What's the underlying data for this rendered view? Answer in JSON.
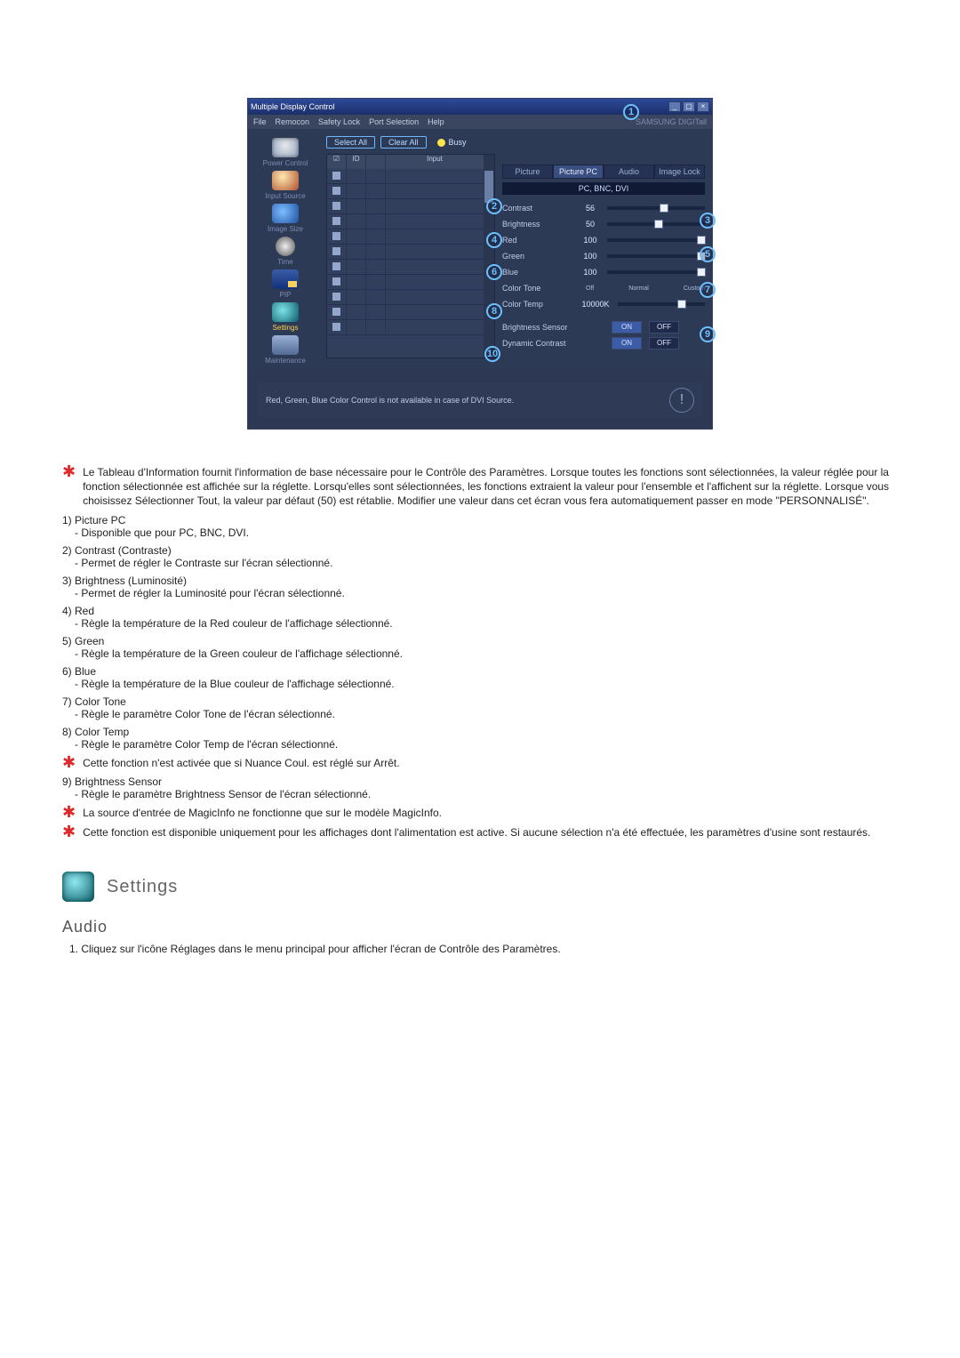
{
  "app": {
    "title": "Multiple Display Control",
    "menus": [
      "File",
      "Remocon",
      "Safety Lock",
      "Port Selection",
      "Help"
    ],
    "brand": "SAMSUNG DIGITall"
  },
  "sidebar": {
    "items": [
      {
        "label": "Power Control"
      },
      {
        "label": "Input Source"
      },
      {
        "label": "Image Size"
      },
      {
        "label": "Time"
      },
      {
        "label": "PIP"
      },
      {
        "label": "Settings"
      },
      {
        "label": "Maintenance"
      }
    ]
  },
  "listpanel": {
    "select_all": "Select All",
    "clear_all": "Clear All",
    "busy": "Busy",
    "cols": {
      "chk": "",
      "id": "ID",
      "st": "",
      "input": "Input"
    }
  },
  "rightpanel": {
    "tabs": [
      "Picture",
      "Picture PC",
      "Audio",
      "Image Lock"
    ],
    "active_tab": 1,
    "banner": "PC, BNC, DVI",
    "sliders": {
      "contrast": {
        "label": "Contrast",
        "val": "56",
        "pct": 56
      },
      "brightness": {
        "label": "Brightness",
        "val": "50",
        "pct": 50
      },
      "red": {
        "label": "Red",
        "val": "100",
        "pct": 100
      },
      "green": {
        "label": "Green",
        "val": "100",
        "pct": 100
      },
      "blue": {
        "label": "Blue",
        "val": "100",
        "pct": 100
      }
    },
    "colortone": {
      "label": "Color Tone",
      "opts": [
        "Off",
        "Normal",
        "Custom"
      ]
    },
    "colortemp": {
      "label": "Color Temp",
      "val": "10000K"
    },
    "bsensor": {
      "label": "Brightness Sensor",
      "on": "ON",
      "off": "OFF"
    },
    "dcontrast": {
      "label": "Dynamic Contrast",
      "on": "ON",
      "off": "OFF"
    }
  },
  "callouts": [
    "1",
    "2",
    "3",
    "4",
    "5",
    "6",
    "7",
    "8",
    "9",
    "10"
  ],
  "notebar": "Red, Green, Blue Color Control is not available in case of DVI Source.",
  "doc": {
    "intro_star": "Le Tableau d'Information fournit l'information de base nécessaire pour le Contrôle des Paramètres. Lorsque toutes les fonctions sont sélectionnées, la valeur réglée pour la fonction sélectionnée est affichée sur la réglette. Lorsqu'elles sont sélectionnées, les fonctions extraient la valeur pour l'ensemble et l'affichent sur la réglette. Lorsque vous choisissez Sélectionner Tout, la valeur par défaut (50) est rétablie. Modifier une valeur dans cet écran vous fera automatiquement passer en mode \"PERSONNALISÉ\".",
    "items": [
      {
        "lbl": "1) Picture PC",
        "desc": "Disponible que pour PC, BNC, DVI."
      },
      {
        "lbl": "2) Contrast (Contraste)",
        "desc": "Permet de régler le Contraste sur l'écran sélectionné."
      },
      {
        "lbl": "3) Brightness (Luminosité)",
        "desc": "Permet de régler la Luminosité pour l'écran sélectionné."
      },
      {
        "lbl": "4) Red",
        "desc": "Règle la température de la Red couleur de l'affichage sélectionné."
      },
      {
        "lbl": "5) Green",
        "desc": "Règle la température de la Green couleur de l'affichage sélectionné."
      },
      {
        "lbl": "6) Blue",
        "desc": "Règle la température de la Blue couleur de l'affichage sélectionné."
      },
      {
        "lbl": "7) Color Tone",
        "desc": "Règle le paramètre Color Tone de l'écran sélectionné."
      },
      {
        "lbl": "8) Color Temp",
        "desc": "Règle le paramètre Color Temp de l'écran sélectionné."
      }
    ],
    "star_after8": "Cette fonction n'est activée que si Nuance Coul. est réglé sur Arrêt.",
    "item9": {
      "lbl": "9) Brightness Sensor",
      "desc": "Règle le paramètre Brightness Sensor de l'écran sélectionné."
    },
    "star_mi": "La source d'entrée de MagicInfo ne fonctionne que sur le modèle MagicInfo.",
    "star_pw": "Cette fonction est disponible uniquement pour les affichages dont l'alimentation est active. Si aucune sélection n'a été effectuée, les paramètres d'usine sont restaurés.",
    "settings_heading": "Settings",
    "audio_heading": "Audio",
    "audio_step1": "1. Cliquez sur l'icône Réglages dans le menu principal pour afficher l'écran de Contrôle des Paramètres."
  }
}
